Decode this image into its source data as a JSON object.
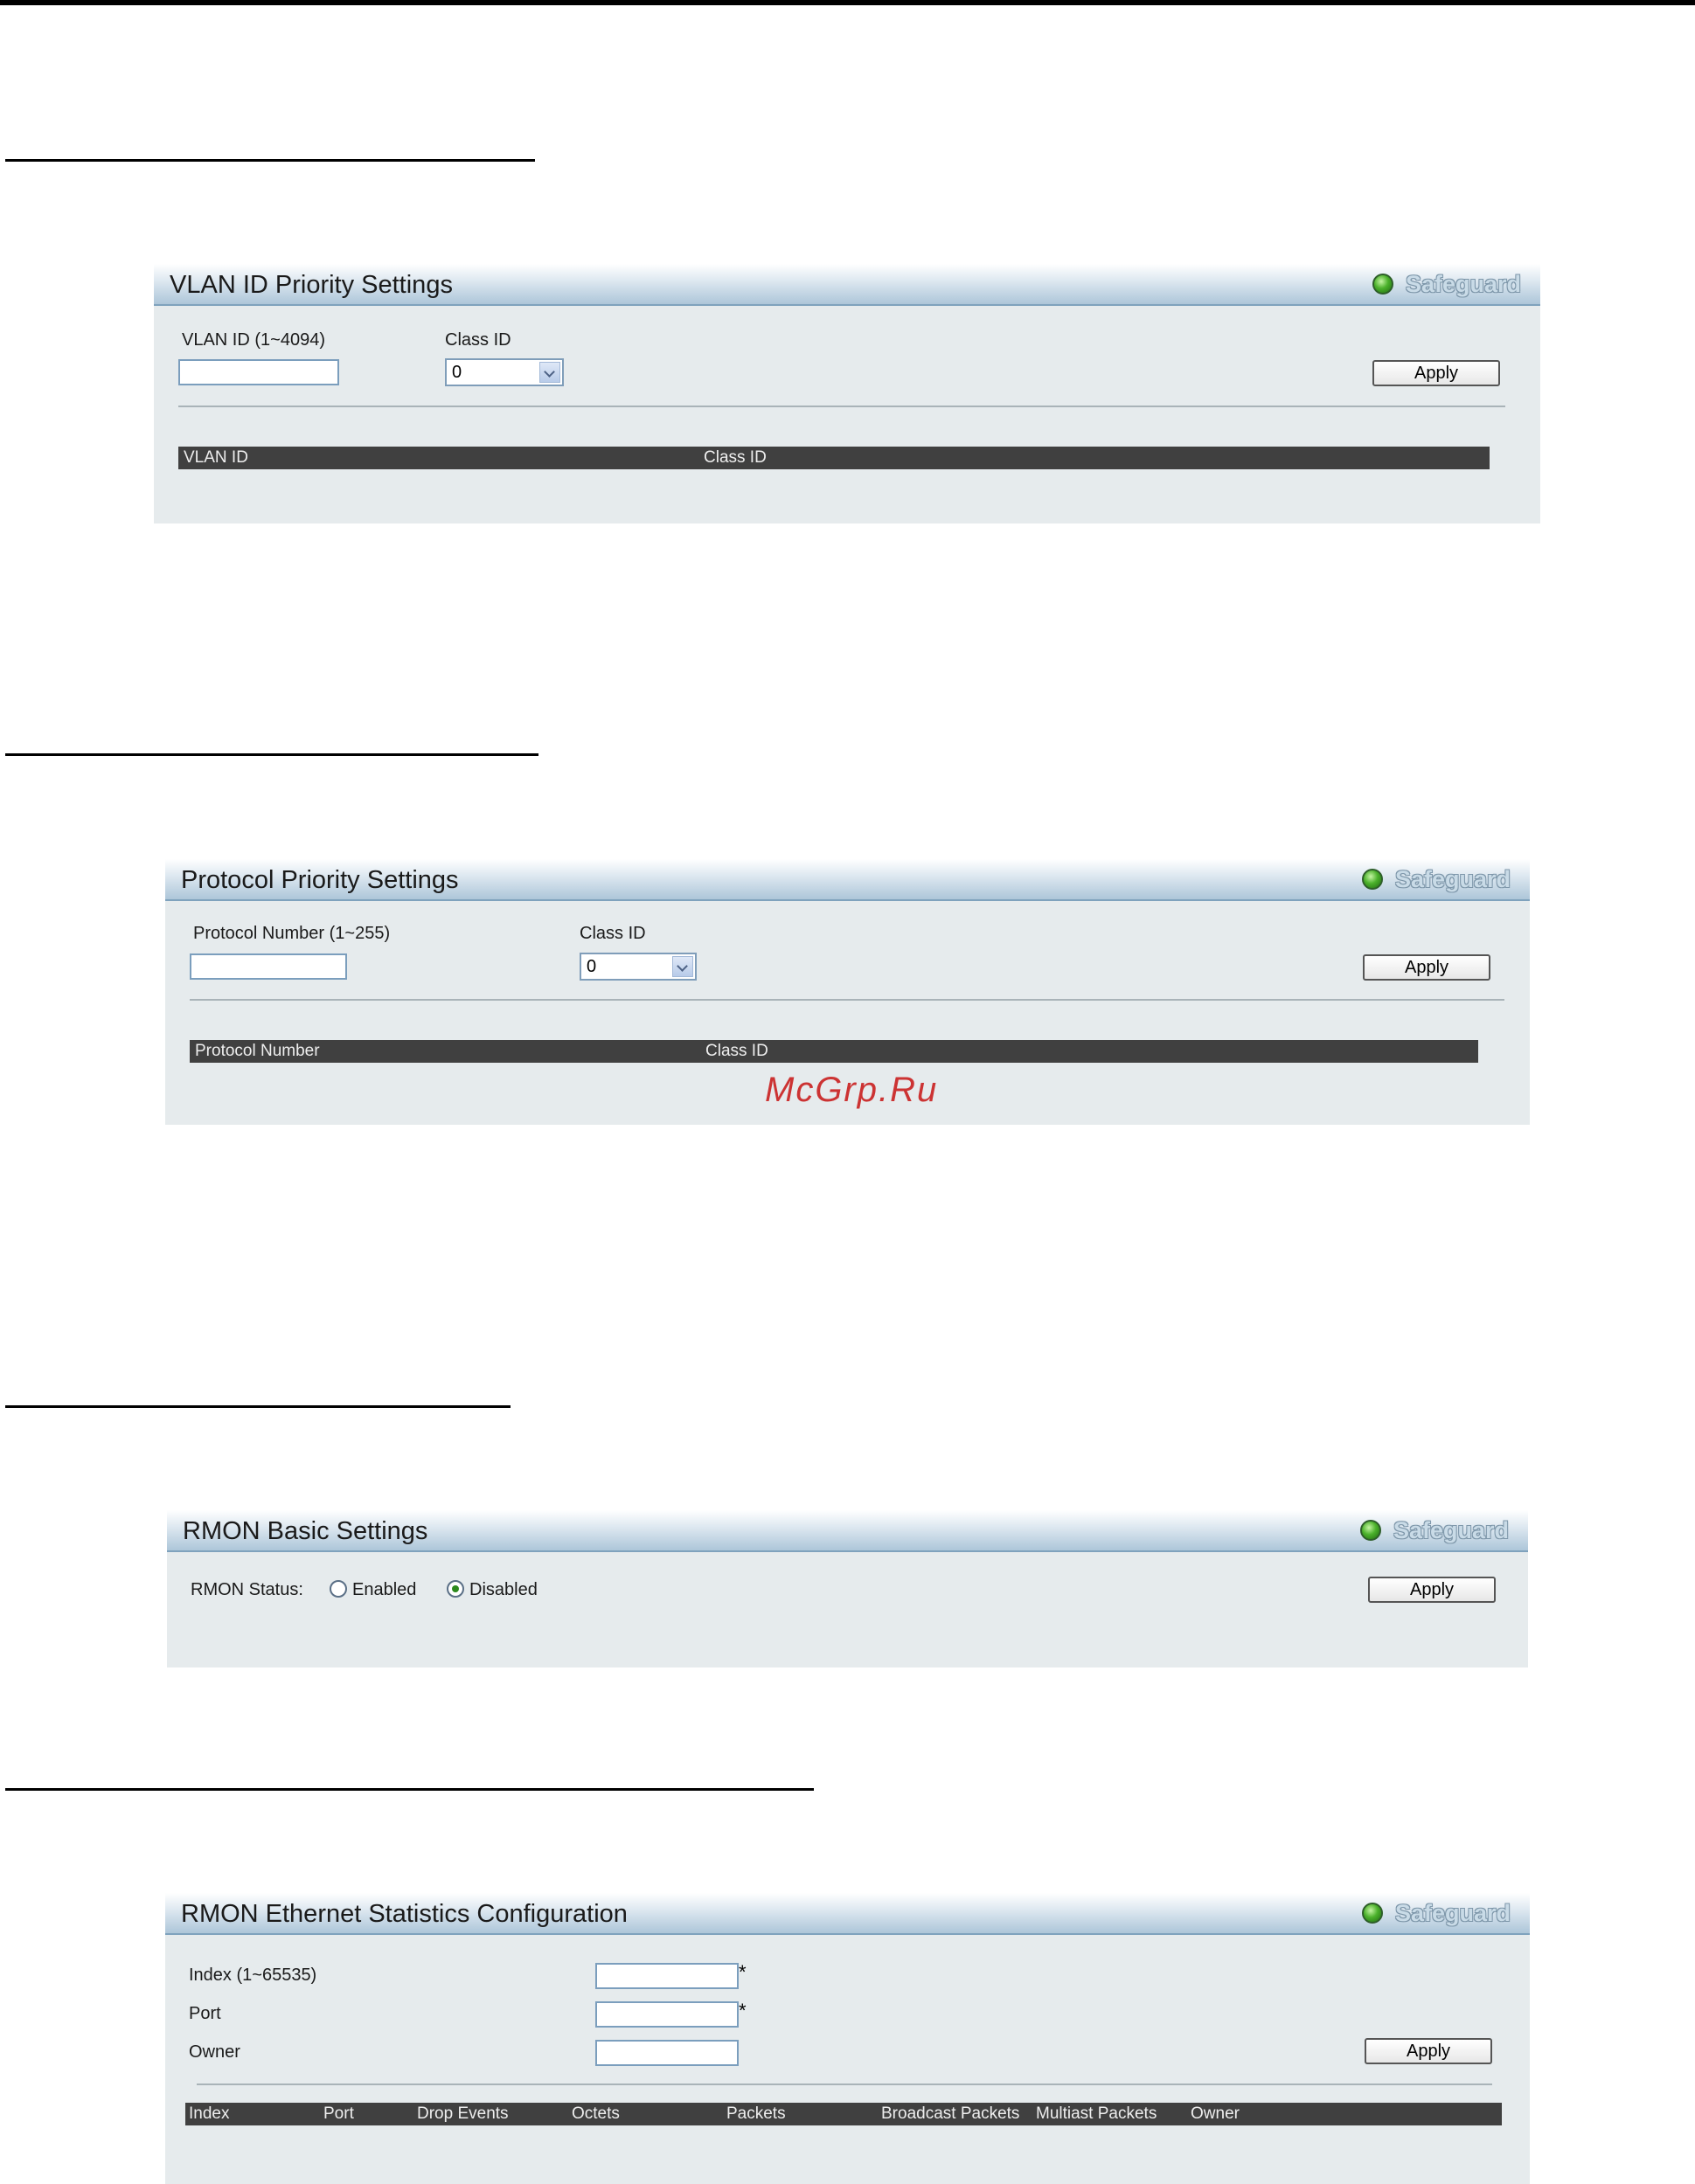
{
  "panels": {
    "vlan": {
      "title": "VLAN ID Priority Settings",
      "safeguard": "Safeguard",
      "vlan_id_label": "VLAN ID (1~4094)",
      "vlan_id_value": "",
      "class_id_label": "Class ID",
      "class_id_value": "0",
      "apply": "Apply",
      "columns": [
        "VLAN ID",
        "Class ID"
      ]
    },
    "protocol": {
      "title": "Protocol Priority Settings",
      "safeguard": "Safeguard",
      "protocol_label": "Protocol Number (1~255)",
      "protocol_value": "",
      "class_id_label": "Class ID",
      "class_id_value": "0",
      "apply": "Apply",
      "columns": [
        "Protocol Number",
        "Class ID"
      ]
    },
    "rmon_basic": {
      "title": "RMON Basic Settings",
      "safeguard": "Safeguard",
      "status_label": "RMON Status:",
      "enabled_label": "Enabled",
      "disabled_label": "Disabled",
      "selected": "Disabled",
      "apply": "Apply"
    },
    "rmon_eth": {
      "title": "RMON Ethernet Statistics Configuration",
      "safeguard": "Safeguard",
      "index_label": "Index (1~65535)",
      "port_label": "Port",
      "owner_label": "Owner",
      "required_mark": "*",
      "apply": "Apply",
      "columns": [
        "Index",
        "Port",
        "Drop Events",
        "Octets",
        "Packets",
        "Broadcast Packets",
        "Multiast Packets",
        "Owner"
      ]
    }
  },
  "watermark": "McGrp.Ru",
  "colors": {
    "panel_bg": "#e6ebed",
    "table_header": "#404040",
    "safeguard_dot": "#4bb12b"
  }
}
